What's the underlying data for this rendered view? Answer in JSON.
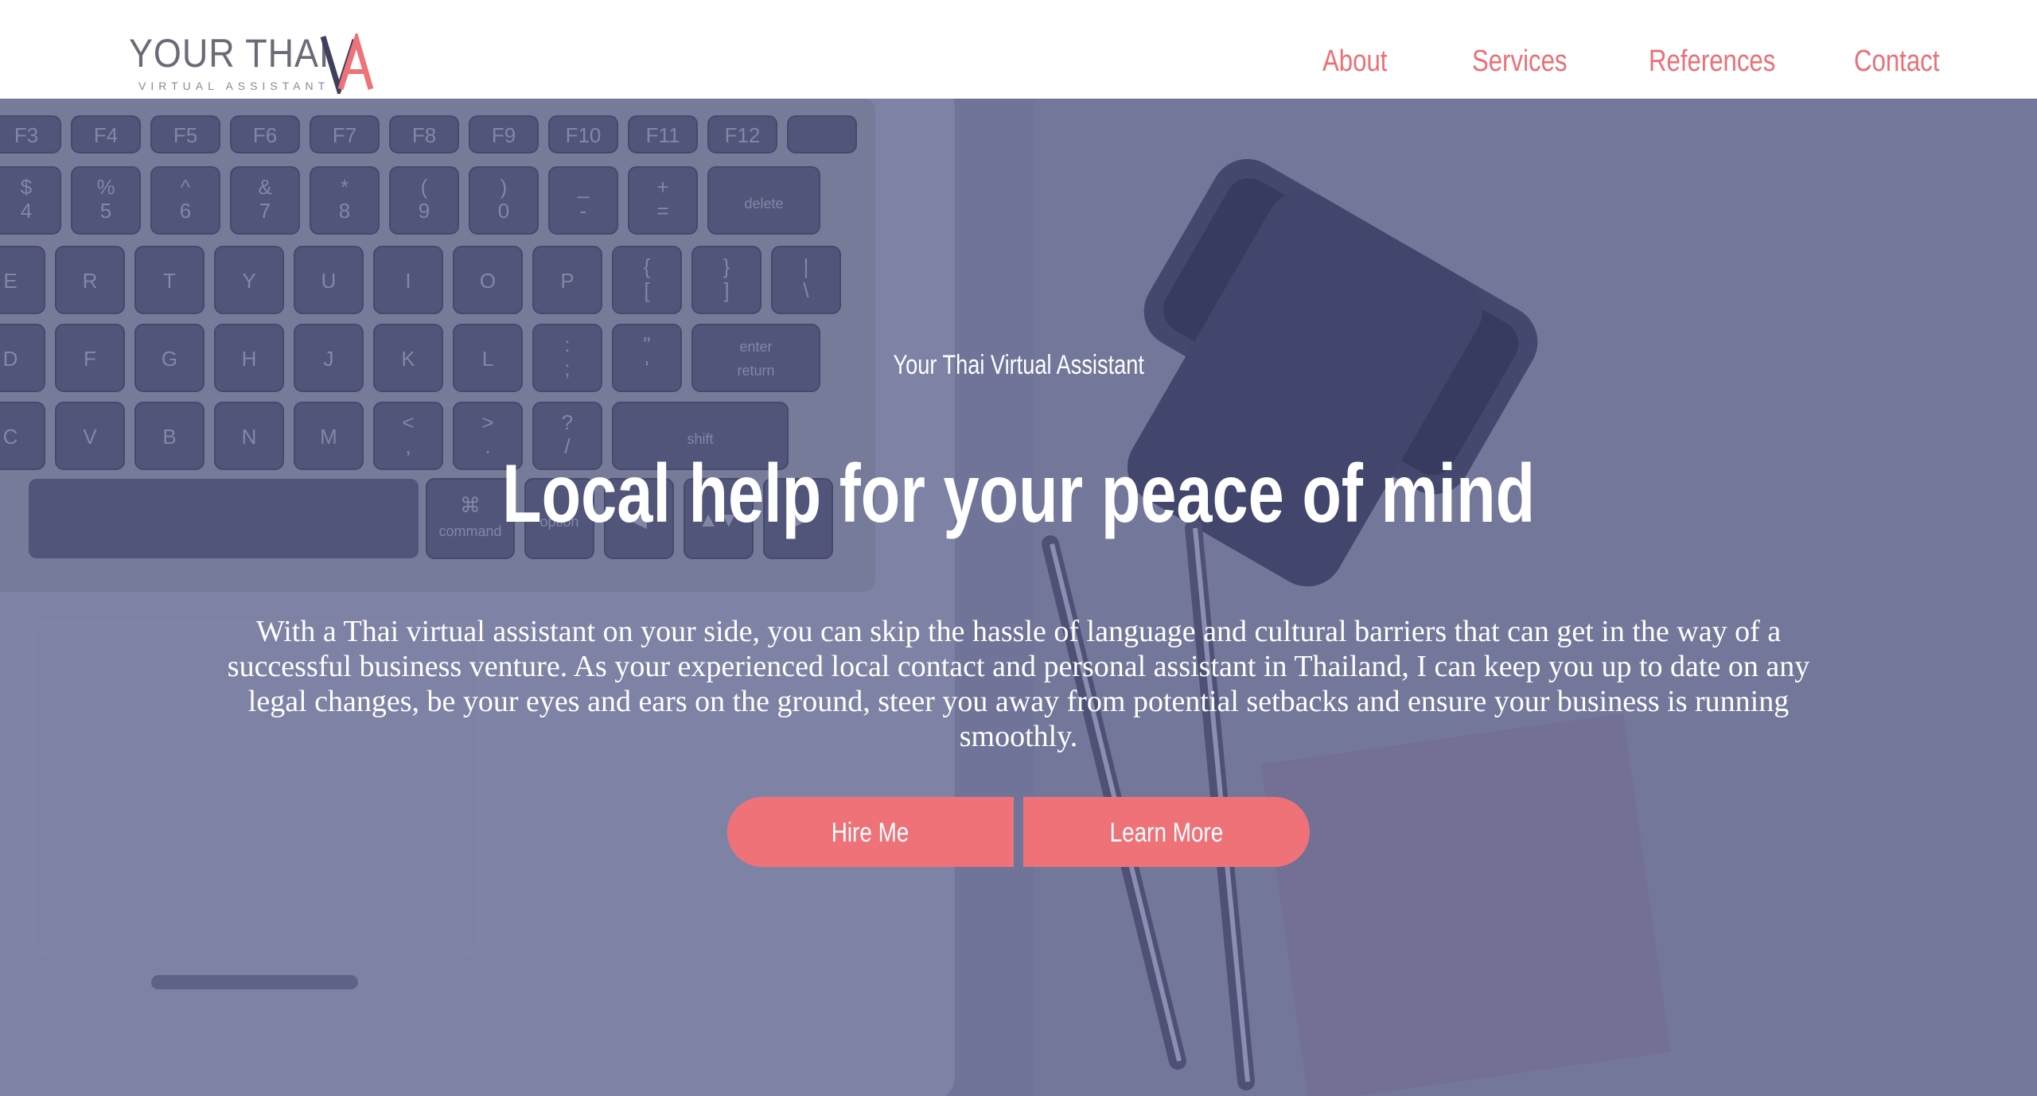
{
  "brand": {
    "name": "YOUR THAI",
    "tagline": "VIRTUAL ASSISTANT",
    "mark_icon": "va-monogram-icon"
  },
  "nav": {
    "items": [
      {
        "label": "About"
      },
      {
        "label": "Services"
      },
      {
        "label": "References"
      },
      {
        "label": "Contact"
      }
    ]
  },
  "hero": {
    "kicker": "Your Thai Virtual Assistant",
    "title": "Local help for your peace of mind",
    "body": "With a Thai virtual assistant on your side, you can skip the hassle of language and cultural barriers that can get in the way of a successful business venture. As your experienced local contact and personal assistant in Thailand, I can keep you up to date on any legal changes, be your eyes and ears on the ground, steer you away from potential setbacks and ensure your business is running smoothly.",
    "buttons": {
      "hire": "Hire Me",
      "learn": "Learn More"
    },
    "background_icon": "desk-laptop-phone-pens-photo"
  },
  "colors": {
    "accent": "#ef7279",
    "nav_text": "#ec6f75",
    "logo_text": "#6b6b78",
    "logo_mark_dark": "#3d3f5c",
    "hero_tint": "#6e7396",
    "white": "#ffffff"
  },
  "keyboard_keys": {
    "row1": [
      "F3",
      "F4",
      "F5",
      "F6",
      "F7",
      "F8",
      "F9",
      "F10",
      "F11",
      "F12",
      ""
    ],
    "row2": [
      "$\n4",
      "%\n5",
      "^\n6",
      "&\n7",
      "*\n8",
      "(\n9",
      ")\n0",
      "_\n-",
      "+\n=",
      "delete"
    ],
    "row3": [
      "E",
      "R",
      "T",
      "Y",
      "U",
      "I",
      "O",
      "P",
      "{\n[",
      "}\n]",
      "|\n\\"
    ],
    "row4": [
      "D",
      "F",
      "G",
      "H",
      "J",
      "K",
      "L",
      ":\n;",
      "\"\n'",
      "enter\nreturn"
    ],
    "row5": [
      "C",
      "V",
      "B",
      "N",
      "M",
      "<\n,",
      ">\n.",
      "?\n/",
      "shift"
    ],
    "row6": [
      "",
      "⌘\ncommand",
      "option",
      "◀",
      "▲▼",
      "▶"
    ]
  }
}
